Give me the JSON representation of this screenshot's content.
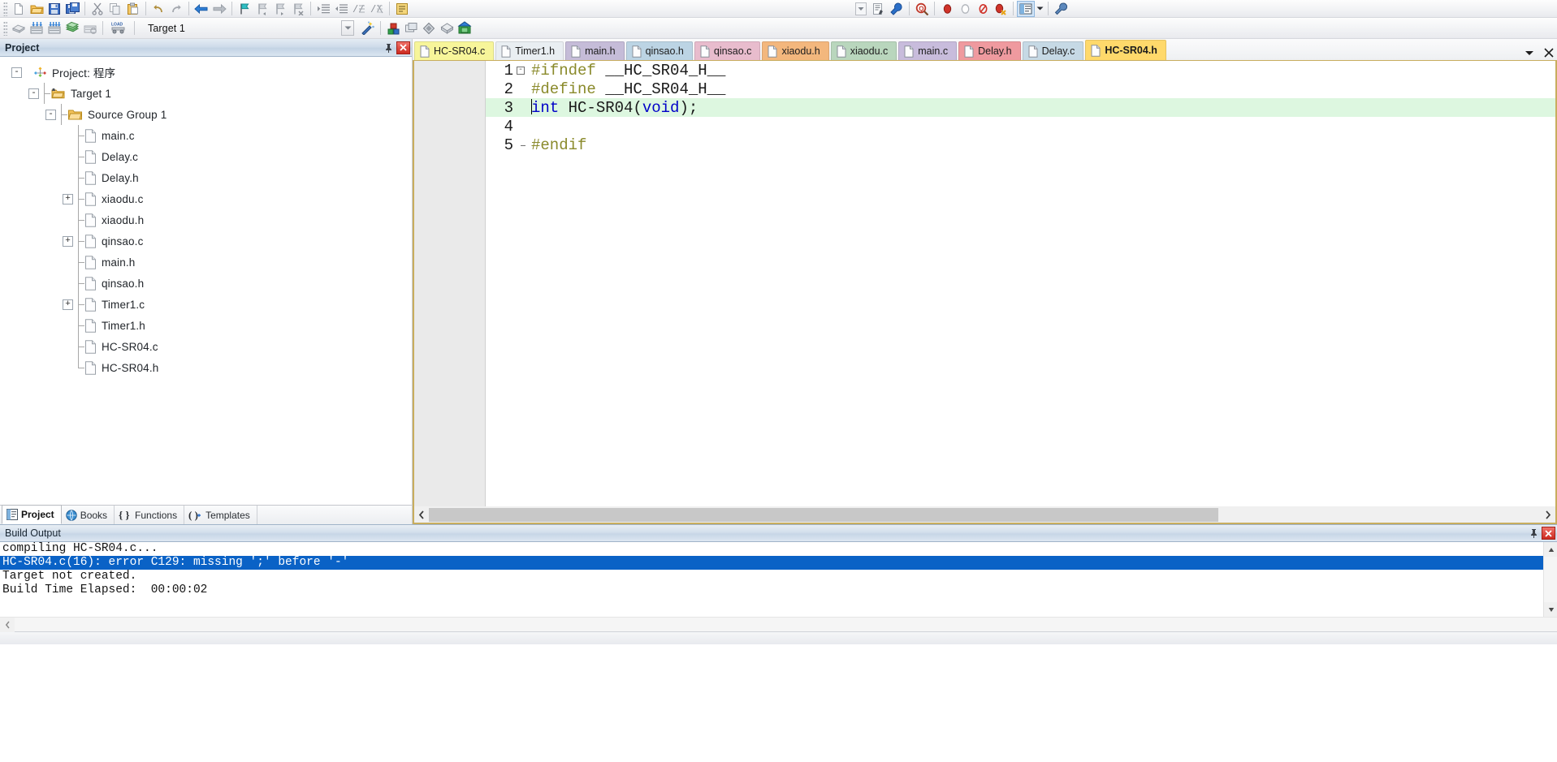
{
  "toolbar1": {
    "buttons": [
      {
        "name": "new-file",
        "icon": "new-file-icon"
      },
      {
        "name": "open-file",
        "icon": "open-folder-icon"
      },
      {
        "name": "save",
        "icon": "save-icon"
      },
      {
        "name": "save-all",
        "icon": "save-all-icon"
      },
      {
        "name": "cut",
        "icon": "scissors-icon"
      },
      {
        "name": "copy",
        "icon": "copy-icon"
      },
      {
        "name": "paste",
        "icon": "paste-icon"
      },
      {
        "name": "undo",
        "icon": "undo-arrow-icon"
      },
      {
        "name": "redo",
        "icon": "redo-arrow-icon"
      },
      {
        "name": "navigate-backward",
        "icon": "arrow-left-icon"
      },
      {
        "name": "navigate-forward",
        "icon": "arrow-right-icon"
      },
      {
        "name": "bookmark-toggle",
        "icon": "bookmark-flag-icon"
      },
      {
        "name": "bookmark-prev",
        "icon": "bookmark-prev-icon"
      },
      {
        "name": "bookmark-next",
        "icon": "bookmark-next-icon"
      },
      {
        "name": "bookmark-clear",
        "icon": "bookmark-clear-icon"
      },
      {
        "name": "indent-increase",
        "icon": "indent-right-icon"
      },
      {
        "name": "indent-decrease",
        "icon": "indent-left-icon"
      },
      {
        "name": "comment-lines",
        "icon": "comment-icon"
      },
      {
        "name": "uncomment-lines",
        "icon": "uncomment-icon"
      },
      {
        "name": "configuration-wizard",
        "icon": "wizard-page-icon"
      },
      {
        "name": "debug-dropdown",
        "icon": "chevron-down-icon"
      },
      {
        "name": "insert-comment-block",
        "icon": "doc-pencil-icon"
      },
      {
        "name": "goto-definition",
        "icon": "blue-wrench-icon"
      },
      {
        "name": "find-in-files",
        "icon": "magnifier-q-icon"
      },
      {
        "name": "insert-breakpoint",
        "icon": "breakpoint-red-icon"
      },
      {
        "name": "kill-breakpoint",
        "icon": "breakpoint-hollow-icon"
      },
      {
        "name": "disable-breakpoint",
        "icon": "breakpoint-disabled-icon"
      },
      {
        "name": "kill-all-breakpoints",
        "icon": "breakpoint-delete-icon"
      },
      {
        "name": "window-layout",
        "icon": "window-layout-icon"
      },
      {
        "name": "window-layout-dropdown",
        "icon": "chevron-down-small-icon"
      },
      {
        "name": "configure-tools",
        "icon": "wrench-icon"
      }
    ]
  },
  "toolbar2": {
    "buttons": [
      {
        "name": "translate-file",
        "icon": "translate-icon"
      },
      {
        "name": "build-target",
        "icon": "build-icon"
      },
      {
        "name": "rebuild-all",
        "icon": "rebuild-icon"
      },
      {
        "name": "batch-build",
        "icon": "batch-build-icon"
      },
      {
        "name": "stop-build",
        "icon": "stop-build-icon"
      },
      {
        "name": "download",
        "icon": "load-icon"
      }
    ],
    "target_label": "Target 1",
    "after_buttons": [
      {
        "name": "target-options",
        "icon": "magic-wand-icon"
      },
      {
        "name": "manage-project-items",
        "icon": "project-components-icon"
      },
      {
        "name": "manage-multi-project",
        "icon": "multi-project-icon"
      },
      {
        "name": "manage-run-time-env",
        "icon": "diamond-icon"
      },
      {
        "name": "select-software-packs",
        "icon": "pack-icon"
      },
      {
        "name": "pack-installer",
        "icon": "pack-installer-icon"
      }
    ]
  },
  "project_panel": {
    "title": "Project",
    "pin_icon": "pin-icon",
    "close_icon": "close-icon",
    "tree": [
      {
        "label": "Project: 程序",
        "depth": 0,
        "expander": "-",
        "icon": "project-icon"
      },
      {
        "label": "Target 1",
        "depth": 1,
        "expander": "-",
        "icon": "target-icon"
      },
      {
        "label": "Source Group 1",
        "depth": 2,
        "expander": "-",
        "icon": "folder-icon"
      },
      {
        "label": "main.c",
        "depth": 3,
        "expander": "",
        "icon": "file-icon"
      },
      {
        "label": "Delay.c",
        "depth": 3,
        "expander": "",
        "icon": "file-icon"
      },
      {
        "label": "Delay.h",
        "depth": 3,
        "expander": "",
        "icon": "file-icon"
      },
      {
        "label": "xiaodu.c",
        "depth": 3,
        "expander": "+",
        "icon": "file-icon"
      },
      {
        "label": "xiaodu.h",
        "depth": 3,
        "expander": "",
        "icon": "file-icon"
      },
      {
        "label": "qinsao.c",
        "depth": 3,
        "expander": "+",
        "icon": "file-icon"
      },
      {
        "label": "main.h",
        "depth": 3,
        "expander": "",
        "icon": "file-icon"
      },
      {
        "label": "qinsao.h",
        "depth": 3,
        "expander": "",
        "icon": "file-icon"
      },
      {
        "label": "Timer1.c",
        "depth": 3,
        "expander": "+",
        "icon": "file-icon"
      },
      {
        "label": "Timer1.h",
        "depth": 3,
        "expander": "",
        "icon": "file-icon"
      },
      {
        "label": "HC-SR04.c",
        "depth": 3,
        "expander": "",
        "icon": "file-icon"
      },
      {
        "label": "HC-SR04.h",
        "depth": 3,
        "expander": "",
        "icon": "file-icon"
      }
    ],
    "bottom_tabs": [
      {
        "label": "Project",
        "icon": "project-tab-icon",
        "active": true
      },
      {
        "label": "Books",
        "icon": "books-icon",
        "active": false
      },
      {
        "label": "Functions",
        "icon": "functions-braces-icon",
        "active": false
      },
      {
        "label": "Templates",
        "icon": "templates-icon",
        "active": false
      }
    ]
  },
  "editor": {
    "tabs": [
      {
        "label": "HC-SR04.c",
        "color": "#f7f59a",
        "active": false
      },
      {
        "label": "Timer1.h",
        "color": "#e9eef2",
        "active": false
      },
      {
        "label": "main.h",
        "color": "#c5bcd8",
        "active": false
      },
      {
        "label": "qinsao.h",
        "color": "#bcd4e4",
        "active": false
      },
      {
        "label": "qinsao.c",
        "color": "#e8bccd",
        "active": false
      },
      {
        "label": "xiaodu.h",
        "color": "#f3b77d",
        "active": false
      },
      {
        "label": "xiaodu.c",
        "color": "#b9d6bd",
        "active": false
      },
      {
        "label": "main.c",
        "color": "#c8bcdc",
        "active": false
      },
      {
        "label": "Delay.h",
        "color": "#ef9a9f",
        "active": false
      },
      {
        "label": "Delay.c",
        "color": "#c6d9e5",
        "active": false
      },
      {
        "label": "HC-SR04.h",
        "color": "#ffd96b",
        "active": true
      }
    ],
    "tab_dropdown_icon": "chevron-down-icon",
    "tab_close_icon": "close-icon",
    "lines": [
      {
        "num": "1",
        "fold": "-",
        "highlight": false,
        "tokens": [
          {
            "t": "#ifndef",
            "c": "pp"
          },
          {
            "t": " __HC_SR04_H__",
            "c": "plain"
          }
        ]
      },
      {
        "num": "2",
        "fold": "",
        "highlight": false,
        "tokens": [
          {
            "t": "#define",
            "c": "pp"
          },
          {
            "t": " __HC_SR04_H__",
            "c": "plain"
          }
        ]
      },
      {
        "num": "3",
        "fold": "",
        "highlight": true,
        "tokens": [
          {
            "t": "int",
            "c": "blue"
          },
          {
            "t": " HC-SR04(",
            "c": "plain"
          },
          {
            "t": "void",
            "c": "blue"
          },
          {
            "t": ");",
            "c": "plain"
          }
        ]
      },
      {
        "num": "4",
        "fold": "",
        "highlight": false,
        "tokens": []
      },
      {
        "num": "5",
        "fold": "L",
        "highlight": false,
        "tokens": [
          {
            "t": "#endif",
            "c": "pp"
          }
        ]
      }
    ],
    "hscroll_left_icon": "chevron-left-icon",
    "hscroll_right_icon": "chevron-right-icon"
  },
  "build_output": {
    "title": "Build Output",
    "pin_icon": "pin-icon",
    "close_icon": "close-icon",
    "lines": [
      {
        "text": "compiling HC-SR04.c...",
        "selected": false
      },
      {
        "text": "HC-SR04.c(16): error C129: missing ';' before '-'",
        "selected": true
      },
      {
        "text": "Target not created.",
        "selected": false
      },
      {
        "text": "Build Time Elapsed:  00:00:02",
        "selected": false
      }
    ],
    "scroll_up_icon": "caret-up-icon",
    "scroll_down_icon": "caret-down-icon",
    "hscroll_left_icon": "chevron-left-icon"
  },
  "colors": {
    "selection_blue": "#0a62c6",
    "highlight_green": "#ddf7e0",
    "panel_header_blue": "#c3d3e4",
    "active_tab_yellow": "#ffd96b",
    "editor_border_gold": "#c8ad5e"
  }
}
